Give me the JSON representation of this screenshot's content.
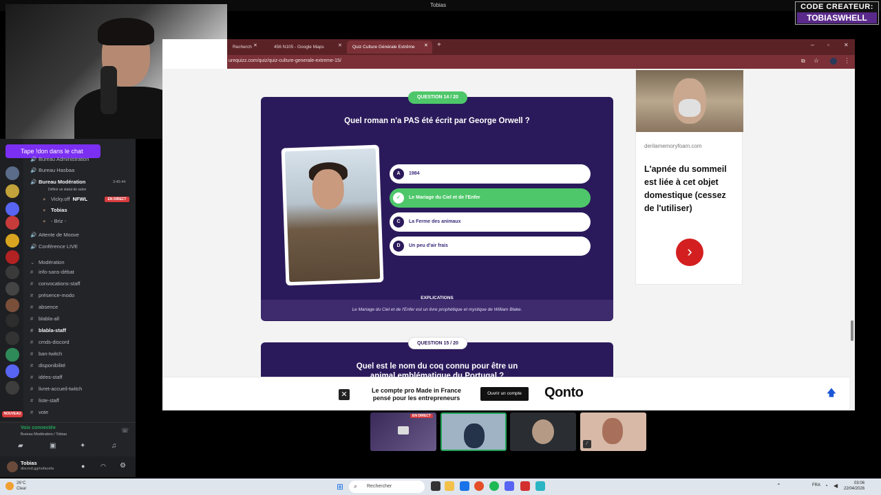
{
  "window": {
    "title": "Tobias"
  },
  "overlay": {
    "creator_line1": "CODE CREATEUR:",
    "creator_line2": "TOBIASWHELL",
    "chat_prompt": "Tape !don dans le chat"
  },
  "discord": {
    "channels": [
      {
        "label": "Bureau Administration",
        "kind": "voice"
      },
      {
        "label": "Bureau Hasbaa",
        "kind": "voice"
      },
      {
        "label": "Bureau Modération",
        "kind": "voice",
        "bold": true,
        "timer": "3:45:44"
      },
      {
        "label": "Définir un statut de salon",
        "kind": "sub"
      },
      {
        "label": "Vicky.off",
        "kind": "user",
        "tag": "NFWL"
      },
      {
        "label": "Tobias",
        "kind": "user",
        "bold": true
      },
      {
        "label": "- Briz -",
        "kind": "user"
      },
      {
        "label": "Attente de Moove",
        "kind": "voice"
      },
      {
        "label": "Conférence LIVE",
        "kind": "voice"
      },
      {
        "label": "Modération",
        "kind": "category"
      },
      {
        "label": "info-sans-débat",
        "kind": "text"
      },
      {
        "label": "convocations-staff",
        "kind": "text"
      },
      {
        "label": "présence-modo",
        "kind": "text"
      },
      {
        "label": "absence",
        "kind": "text"
      },
      {
        "label": "blabla-all",
        "kind": "text"
      },
      {
        "label": "blabla-staff",
        "kind": "text",
        "bold": true
      },
      {
        "label": "cmds-discord",
        "kind": "text"
      },
      {
        "label": "ban-twitch",
        "kind": "text"
      },
      {
        "label": "disponibilité",
        "kind": "text"
      },
      {
        "label": "idées-staff",
        "kind": "text"
      },
      {
        "label": "livret-accueil-twitch",
        "kind": "text"
      },
      {
        "label": "liste-staff",
        "kind": "text"
      },
      {
        "label": "vote",
        "kind": "text"
      }
    ],
    "live_badge": "EN DIRECT",
    "new_badge": "NOUVEAU",
    "voice_status": "Voix connectée",
    "voice_location": "Bureau Modération / Tobias",
    "user_name": "Tobias",
    "user_sub": "discord.gg/nofacefa"
  },
  "browser": {
    "tabs": [
      {
        "label": "Recherch",
        "active": false
      },
      {
        "label": "456 N105 - Google Maps",
        "active": false
      },
      {
        "label": "Quiz Culture Générale Extrême",
        "active": true
      }
    ],
    "url": "urequizz.com/quiz/quiz-culture-generale-extreme-15/"
  },
  "quiz": {
    "q14": {
      "badge": "QUESTION 14 / 20",
      "title": "Quel roman n'a PAS été écrit par George Orwell ?",
      "options": [
        {
          "letter": "A",
          "text": "1984",
          "correct": false
        },
        {
          "letter": "✓",
          "text": "Le Mariage du Ciel et de l'Enfer",
          "correct": true
        },
        {
          "letter": "C",
          "text": "La Ferme des animaux",
          "correct": false
        },
        {
          "letter": "D",
          "text": "Un peu d'air frais",
          "correct": false
        }
      ],
      "explain_label": "EXPLICATIONS",
      "explanation": "Le Mariage du Ciel et de l'Enfer est un livre prophétique et mystique de William Blake."
    },
    "q15": {
      "badge": "QUESTION 15 / 20",
      "title": "Quel est le nom du coq connu pour être un animal emblématique du Portugal ?"
    }
  },
  "side_ad": {
    "domain": "derilamemoryfoam.com",
    "headline": "L'apnée du sommeil est liée à cet objet domestique (cessez de l'utiliser)"
  },
  "bottom_ad": {
    "text": "Le compte pro Made in France pensé pour les entrepreneurs",
    "cta": "Ouvrir un compte",
    "brand": "Qonto"
  },
  "tiles": [
    {
      "badge": "EN DIRECT"
    }
  ],
  "taskbar": {
    "weather_temp": "26°C",
    "weather_desc": "Clear",
    "search": "Rechercher",
    "lang": "FRA",
    "time": "03:06",
    "date": "22/04/2026"
  },
  "colors": {
    "quiz_card": "#2b1a5b",
    "correct": "#4ec76a",
    "browser_tabbar": "#5b2226",
    "accent_purple": "#7b2ff2"
  }
}
